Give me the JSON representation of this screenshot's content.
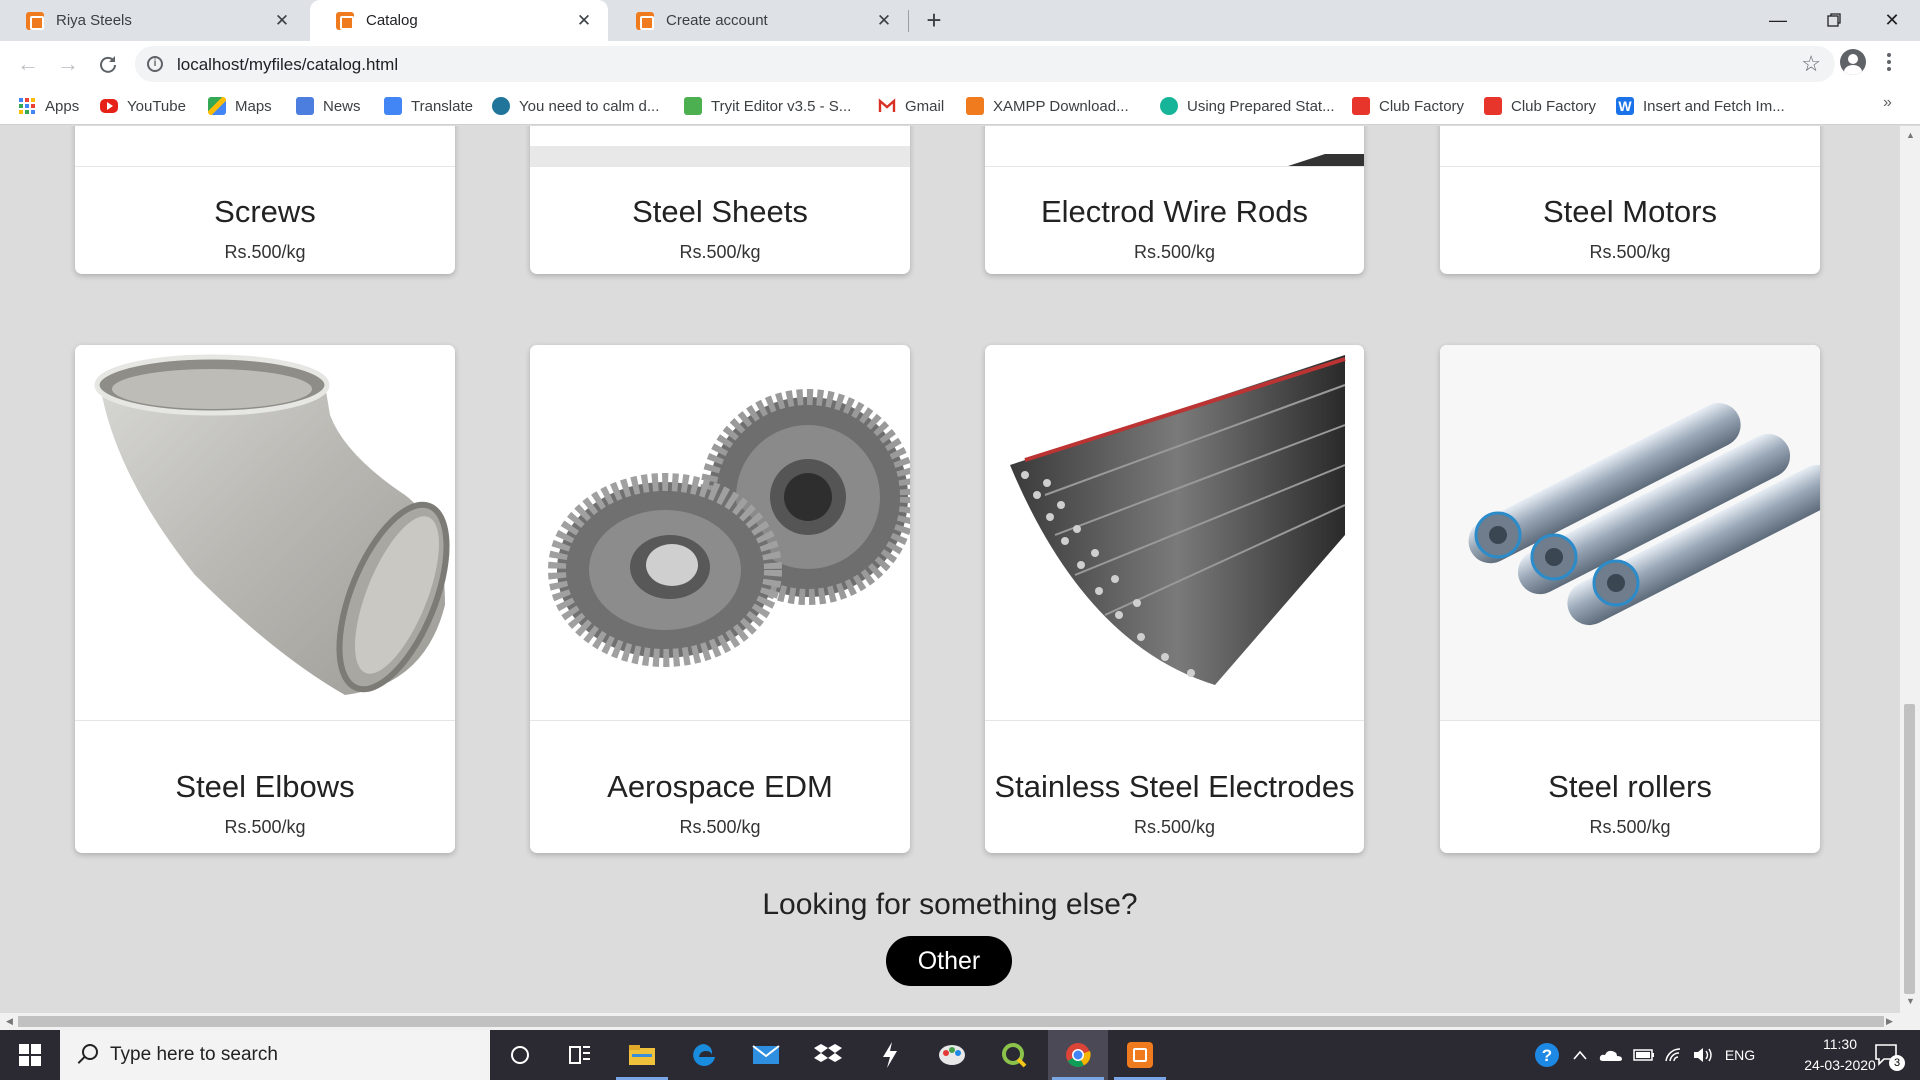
{
  "browser": {
    "tabs": [
      {
        "title": "Riya Steels",
        "active": false
      },
      {
        "title": "Catalog",
        "active": true
      },
      {
        "title": "Create account",
        "active": false
      }
    ],
    "url": "localhost/myfiles/catalog.html",
    "bookmarks": [
      {
        "label": "Apps",
        "icon": "apps-grid-icon"
      },
      {
        "label": "YouTube",
        "icon": "youtube-icon"
      },
      {
        "label": "Maps",
        "icon": "maps-icon"
      },
      {
        "label": "News",
        "icon": "news-icon"
      },
      {
        "label": "Translate",
        "icon": "translate-icon"
      },
      {
        "label": "You need to calm d...",
        "icon": "wordpress-icon"
      },
      {
        "label": "Tryit Editor v3.5 - S...",
        "icon": "w3schools-icon"
      },
      {
        "label": "Gmail",
        "icon": "gmail-icon"
      },
      {
        "label": "XAMPP Download...",
        "icon": "xampp-icon"
      },
      {
        "label": "Using Prepared Stat...",
        "icon": "w3-shield-icon"
      },
      {
        "label": "Club Factory",
        "icon": "club-factory-icon"
      },
      {
        "label": "Club Factory",
        "icon": "club-factory-icon"
      },
      {
        "label": "Insert and Fetch Im...",
        "icon": "w-icon"
      }
    ],
    "bookmarks_more": "»"
  },
  "catalog": {
    "top_row": [
      {
        "name": "Screws",
        "price": "Rs.500/kg"
      },
      {
        "name": "Steel Sheets",
        "price": "Rs.500/kg"
      },
      {
        "name": "Electrod Wire Rods",
        "price": "Rs.500/kg"
      },
      {
        "name": "Steel Motors",
        "price": "Rs.500/kg"
      }
    ],
    "bottom_row": [
      {
        "name": "Steel Elbows",
        "price": "Rs.500/kg",
        "image": "steel-elbow"
      },
      {
        "name": "Aerospace EDM",
        "price": "Rs.500/kg",
        "image": "bevel-gears"
      },
      {
        "name": "Stainless Steel Electrodes",
        "price": "Rs.500/kg",
        "image": "electrode-rods"
      },
      {
        "name": "Steel rollers",
        "price": "Rs.500/kg",
        "image": "steel-rollers"
      }
    ],
    "cta_text": "Looking for something else?",
    "other_button": "Other"
  },
  "taskbar": {
    "search_placeholder": "Type here to search",
    "language": "ENG",
    "time": "11:30",
    "date": "24-03-2020",
    "notification_count": "3"
  }
}
